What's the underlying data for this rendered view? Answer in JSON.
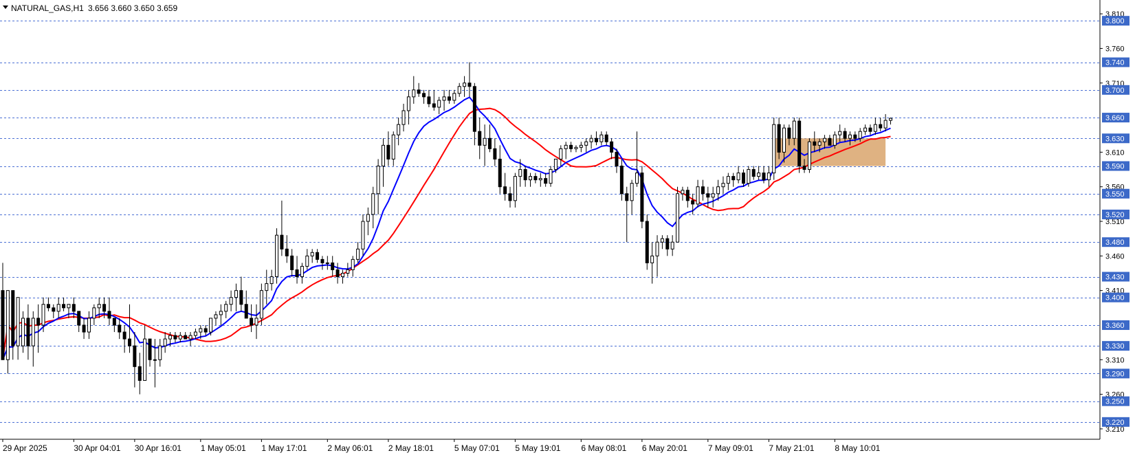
{
  "chart_data": {
    "type": "candlestick",
    "symbol": "NATURAL_GAS,H1",
    "ohlc_header": "3.656 3.660 3.650 3.659",
    "y_range": [
      3.195,
      3.83
    ],
    "price_ticks": [
      "3.810",
      "3.760",
      "3.710",
      "3.610",
      "3.560",
      "3.510",
      "3.460",
      "3.410",
      "3.310",
      "3.260",
      "3.210"
    ],
    "levels": [
      "3.800",
      "3.740",
      "3.700",
      "3.660",
      "3.630",
      "3.590",
      "3.550",
      "3.520",
      "3.480",
      "3.430",
      "3.400",
      "3.360",
      "3.330",
      "3.290",
      "3.250",
      "3.220"
    ],
    "time_labels": [
      {
        "label": "29 Apr 2025",
        "bar": 0
      },
      {
        "label": "30 Apr 04:01",
        "bar": 14
      },
      {
        "label": "30 Apr 16:01",
        "bar": 26
      },
      {
        "label": "1 May 05:01",
        "bar": 39
      },
      {
        "label": "1 May 17:01",
        "bar": 51
      },
      {
        "label": "2 May 06:01",
        "bar": 64
      },
      {
        "label": "2 May 18:01",
        "bar": 76
      },
      {
        "label": "5 May 07:01",
        "bar": 89
      },
      {
        "label": "5 May 19:01",
        "bar": 101
      },
      {
        "label": "6 May 08:01",
        "bar": 114
      },
      {
        "label": "6 May 20:01",
        "bar": 126
      },
      {
        "label": "7 May 09:01",
        "bar": 139
      },
      {
        "label": "7 May 21:01",
        "bar": 151
      },
      {
        "label": "8 May 10:01",
        "bar": 164
      }
    ],
    "candles": [
      [
        3.41,
        3.45,
        3.37,
        3.31
      ],
      [
        3.31,
        3.41,
        3.29,
        3.41
      ],
      [
        3.41,
        3.41,
        3.31,
        3.33
      ],
      [
        3.33,
        3.4,
        3.31,
        3.4
      ],
      [
        3.33,
        3.38,
        3.32,
        3.37
      ],
      [
        3.37,
        3.39,
        3.31,
        3.33
      ],
      [
        3.33,
        3.38,
        3.3,
        3.37
      ],
      [
        3.37,
        3.39,
        3.32,
        3.36
      ],
      [
        3.36,
        3.4,
        3.35,
        3.39
      ],
      [
        3.39,
        3.4,
        3.38,
        3.385
      ],
      [
        3.385,
        3.39,
        3.37,
        3.38
      ],
      [
        3.38,
        3.4,
        3.37,
        3.39
      ],
      [
        3.39,
        3.4,
        3.38,
        3.385
      ],
      [
        3.385,
        3.39,
        3.37,
        3.39
      ],
      [
        3.39,
        3.4,
        3.37,
        3.38
      ],
      [
        3.38,
        3.38,
        3.35,
        3.36
      ],
      [
        3.36,
        3.37,
        3.34,
        3.35
      ],
      [
        3.35,
        3.38,
        3.34,
        3.37
      ],
      [
        3.37,
        3.39,
        3.36,
        3.385
      ],
      [
        3.385,
        3.4,
        3.37,
        3.39
      ],
      [
        3.39,
        3.4,
        3.37,
        3.38
      ],
      [
        3.38,
        3.4,
        3.36,
        3.37
      ],
      [
        3.37,
        3.37,
        3.35,
        3.36
      ],
      [
        3.36,
        3.37,
        3.34,
        3.35
      ],
      [
        3.35,
        3.36,
        3.32,
        3.34
      ],
      [
        3.34,
        3.39,
        3.32,
        3.33
      ],
      [
        3.33,
        3.35,
        3.27,
        3.3
      ],
      [
        3.3,
        3.32,
        3.26,
        3.28
      ],
      [
        3.28,
        3.36,
        3.28,
        3.34
      ],
      [
        3.34,
        3.34,
        3.3,
        3.31
      ],
      [
        3.31,
        3.34,
        3.27,
        3.31
      ],
      [
        3.31,
        3.34,
        3.3,
        3.33
      ],
      [
        3.33,
        3.35,
        3.32,
        3.34
      ],
      [
        3.34,
        3.35,
        3.33,
        3.345
      ],
      [
        3.345,
        3.35,
        3.335,
        3.34
      ],
      [
        3.34,
        3.35,
        3.335,
        3.345
      ],
      [
        3.345,
        3.35,
        3.34,
        3.34
      ],
      [
        3.34,
        3.35,
        3.33,
        3.345
      ],
      [
        3.345,
        3.355,
        3.34,
        3.35
      ],
      [
        3.35,
        3.36,
        3.34,
        3.355
      ],
      [
        3.355,
        3.36,
        3.345,
        3.35
      ],
      [
        3.35,
        3.36,
        3.345,
        3.37
      ],
      [
        3.37,
        3.38,
        3.36,
        3.375
      ],
      [
        3.375,
        3.39,
        3.36,
        3.38
      ],
      [
        3.38,
        3.395,
        3.37,
        3.39
      ],
      [
        3.39,
        3.41,
        3.38,
        3.4
      ],
      [
        3.4,
        3.42,
        3.38,
        3.41
      ],
      [
        3.41,
        3.43,
        3.38,
        3.39
      ],
      [
        3.39,
        3.41,
        3.37,
        3.37
      ],
      [
        3.37,
        3.39,
        3.35,
        3.36
      ],
      [
        3.36,
        3.39,
        3.34,
        3.37
      ],
      [
        3.37,
        3.42,
        3.36,
        3.41
      ],
      [
        3.41,
        3.44,
        3.39,
        3.42
      ],
      [
        3.42,
        3.44,
        3.41,
        3.43
      ],
      [
        3.43,
        3.5,
        3.42,
        3.49
      ],
      [
        3.49,
        3.54,
        3.46,
        3.47
      ],
      [
        3.47,
        3.49,
        3.45,
        3.46
      ],
      [
        3.46,
        3.47,
        3.43,
        3.44
      ],
      [
        3.44,
        3.46,
        3.42,
        3.43
      ],
      [
        3.43,
        3.45,
        3.42,
        3.445
      ],
      [
        3.445,
        3.47,
        3.44,
        3.46
      ],
      [
        3.46,
        3.47,
        3.45,
        3.465
      ],
      [
        3.465,
        3.47,
        3.45,
        3.455
      ],
      [
        3.455,
        3.46,
        3.44,
        3.45
      ],
      [
        3.45,
        3.46,
        3.44,
        3.45
      ],
      [
        3.45,
        3.46,
        3.43,
        3.44
      ],
      [
        3.44,
        3.45,
        3.42,
        3.43
      ],
      [
        3.43,
        3.44,
        3.42,
        3.435
      ],
      [
        3.435,
        3.45,
        3.43,
        3.44
      ],
      [
        3.44,
        3.46,
        3.43,
        3.455
      ],
      [
        3.455,
        3.48,
        3.45,
        3.47
      ],
      [
        3.47,
        3.52,
        3.46,
        3.51
      ],
      [
        3.51,
        3.53,
        3.49,
        3.52
      ],
      [
        3.52,
        3.56,
        3.5,
        3.55
      ],
      [
        3.55,
        3.6,
        3.52,
        3.59
      ],
      [
        3.59,
        3.63,
        3.56,
        3.62
      ],
      [
        3.62,
        3.64,
        3.59,
        3.6
      ],
      [
        3.6,
        3.64,
        3.59,
        3.635
      ],
      [
        3.635,
        3.66,
        3.62,
        3.65
      ],
      [
        3.65,
        3.68,
        3.64,
        3.67
      ],
      [
        3.67,
        3.7,
        3.65,
        3.69
      ],
      [
        3.69,
        3.72,
        3.68,
        3.7
      ],
      [
        3.7,
        3.71,
        3.69,
        3.695
      ],
      [
        3.695,
        3.7,
        3.68,
        3.69
      ],
      [
        3.69,
        3.7,
        3.675,
        3.68
      ],
      [
        3.68,
        3.7,
        3.67,
        3.675
      ],
      [
        3.675,
        3.69,
        3.665,
        3.685
      ],
      [
        3.685,
        3.7,
        3.67,
        3.69
      ],
      [
        3.69,
        3.7,
        3.68,
        3.685
      ],
      [
        3.685,
        3.7,
        3.68,
        3.695
      ],
      [
        3.695,
        3.71,
        3.69,
        3.705
      ],
      [
        3.705,
        3.72,
        3.69,
        3.71
      ],
      [
        3.71,
        3.74,
        3.69,
        3.705
      ],
      [
        3.705,
        3.71,
        3.62,
        3.64
      ],
      [
        3.64,
        3.66,
        3.6,
        3.62
      ],
      [
        3.62,
        3.65,
        3.59,
        3.63
      ],
      [
        3.63,
        3.65,
        3.61,
        3.615
      ],
      [
        3.615,
        3.63,
        3.59,
        3.6
      ],
      [
        3.6,
        3.62,
        3.55,
        3.56
      ],
      [
        3.56,
        3.58,
        3.54,
        3.55
      ],
      [
        3.55,
        3.56,
        3.53,
        3.54
      ],
      [
        3.54,
        3.58,
        3.53,
        3.575
      ],
      [
        3.575,
        3.6,
        3.56,
        3.585
      ],
      [
        3.585,
        3.59,
        3.56,
        3.57
      ],
      [
        3.57,
        3.58,
        3.56,
        3.575
      ],
      [
        3.575,
        3.58,
        3.565,
        3.57
      ],
      [
        3.57,
        3.58,
        3.56,
        3.572
      ],
      [
        3.572,
        3.58,
        3.56,
        3.565
      ],
      [
        3.565,
        3.59,
        3.56,
        3.585
      ],
      [
        3.585,
        3.6,
        3.58,
        3.6
      ],
      [
        3.6,
        3.62,
        3.59,
        3.615
      ],
      [
        3.615,
        3.625,
        3.6,
        3.62
      ],
      [
        3.62,
        3.625,
        3.61,
        3.615
      ],
      [
        3.615,
        3.62,
        3.61,
        3.617
      ],
      [
        3.617,
        3.625,
        3.61,
        3.62
      ],
      [
        3.62,
        3.63,
        3.61,
        3.625
      ],
      [
        3.625,
        3.635,
        3.615,
        3.63
      ],
      [
        3.63,
        3.64,
        3.62,
        3.625
      ],
      [
        3.625,
        3.64,
        3.62,
        3.635
      ],
      [
        3.635,
        3.64,
        3.62,
        3.625
      ],
      [
        3.625,
        3.63,
        3.6,
        3.61
      ],
      [
        3.61,
        3.615,
        3.58,
        3.59
      ],
      [
        3.59,
        3.6,
        3.54,
        3.55
      ],
      [
        3.55,
        3.56,
        3.48,
        3.54
      ],
      [
        3.54,
        3.57,
        3.52,
        3.565
      ],
      [
        3.565,
        3.64,
        3.56,
        3.58
      ],
      [
        3.58,
        3.59,
        3.5,
        3.51
      ],
      [
        3.51,
        3.52,
        3.44,
        3.45
      ],
      [
        3.45,
        3.48,
        3.42,
        3.46
      ],
      [
        3.46,
        3.49,
        3.43,
        3.48
      ],
      [
        3.48,
        3.49,
        3.47,
        3.485
      ],
      [
        3.485,
        3.49,
        3.46,
        3.47
      ],
      [
        3.47,
        3.49,
        3.46,
        3.48
      ],
      [
        3.48,
        3.56,
        3.48,
        3.55
      ],
      [
        3.55,
        3.56,
        3.54,
        3.555
      ],
      [
        3.555,
        3.56,
        3.53,
        3.54
      ],
      [
        3.54,
        3.55,
        3.52,
        3.535
      ],
      [
        3.535,
        3.57,
        3.53,
        3.56
      ],
      [
        3.56,
        3.57,
        3.54,
        3.55
      ],
      [
        3.55,
        3.56,
        3.53,
        3.545
      ],
      [
        3.545,
        3.56,
        3.53,
        3.55
      ],
      [
        3.55,
        3.57,
        3.54,
        3.56
      ],
      [
        3.56,
        3.575,
        3.55,
        3.565
      ],
      [
        3.565,
        3.58,
        3.555,
        3.575
      ],
      [
        3.575,
        3.58,
        3.56,
        3.57
      ],
      [
        3.57,
        3.59,
        3.565,
        3.58
      ],
      [
        3.58,
        3.585,
        3.56,
        3.565
      ],
      [
        3.565,
        3.59,
        3.56,
        3.585
      ],
      [
        3.585,
        3.59,
        3.57,
        3.575
      ],
      [
        3.575,
        3.59,
        3.57,
        3.58
      ],
      [
        3.58,
        3.59,
        3.565,
        3.57
      ],
      [
        3.57,
        3.59,
        3.56,
        3.58
      ],
      [
        3.58,
        3.66,
        3.57,
        3.65
      ],
      [
        3.65,
        3.66,
        3.6,
        3.61
      ],
      [
        3.61,
        3.65,
        3.595,
        3.645
      ],
      [
        3.645,
        3.65,
        3.62,
        3.63
      ],
      [
        3.63,
        3.66,
        3.62,
        3.655
      ],
      [
        3.655,
        3.66,
        3.58,
        3.59
      ],
      [
        3.59,
        3.6,
        3.58,
        3.585
      ],
      [
        3.585,
        3.63,
        3.58,
        3.625
      ],
      [
        3.625,
        3.64,
        3.61,
        3.62
      ],
      [
        3.62,
        3.63,
        3.61,
        3.625
      ],
      [
        3.625,
        3.635,
        3.615,
        3.63
      ],
      [
        3.63,
        3.635,
        3.62,
        3.62
      ],
      [
        3.62,
        3.64,
        3.615,
        3.635
      ],
      [
        3.635,
        3.65,
        3.625,
        3.64
      ],
      [
        3.64,
        3.645,
        3.625,
        3.63
      ],
      [
        3.63,
        3.64,
        3.62,
        3.635
      ],
      [
        3.635,
        3.64,
        3.625,
        3.63
      ],
      [
        3.63,
        3.645,
        3.625,
        3.64
      ],
      [
        3.64,
        3.65,
        3.635,
        3.645
      ],
      [
        3.645,
        3.65,
        3.635,
        3.64
      ],
      [
        3.64,
        3.66,
        3.635,
        3.65
      ],
      [
        3.65,
        3.66,
        3.64,
        3.645
      ],
      [
        3.645,
        3.665,
        3.64,
        3.656
      ],
      [
        3.656,
        3.66,
        3.65,
        3.659
      ]
    ],
    "ma_fast_color": "#0000ff",
    "ma_slow_color": "#ff0000",
    "zone": {
      "y_top": 3.63,
      "y_bottom": 3.59,
      "bar_start": 152,
      "bar_end": 174,
      "color": "#d9a56c"
    }
  }
}
